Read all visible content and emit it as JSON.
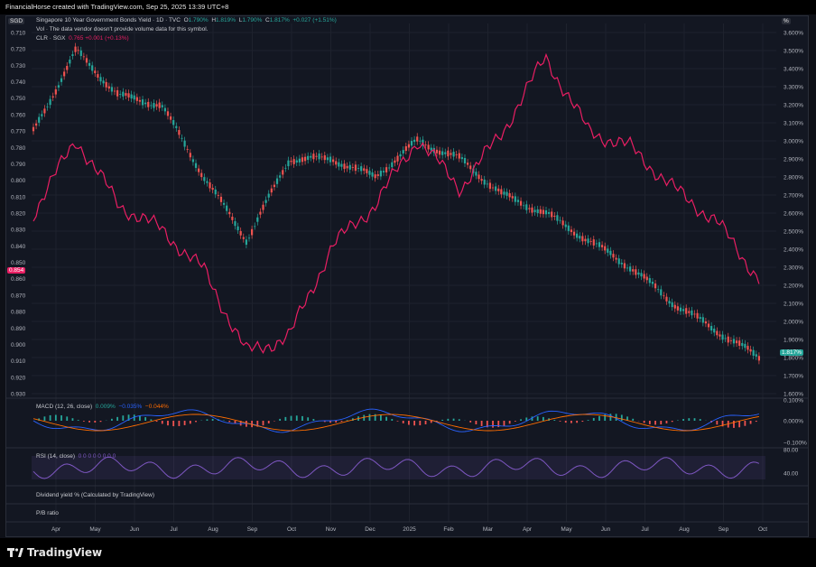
{
  "header": {
    "title": "FinancialHorse created with TradingView.com, Sep 25, 2025 13:39 UTC+8"
  },
  "legend": {
    "main_symbol": "Singapore 10 Year Government Bonds Yield · 1D · TVC",
    "o_label": "O",
    "o_value": "1.790%",
    "h_label": "H",
    "h_value": "1.819%",
    "l_label": "L",
    "l_value": "1.790%",
    "c_label": "C",
    "c_value": "1.817%",
    "change": "+0.027 (+1.51%)",
    "vol_note": "Vol · The data vendor doesn't provide volume data for this symbol.",
    "clr_symbol": "CLR · SGX",
    "clr_value": "0.765 +0.001 (+0.13%)",
    "macd_label": "MACD (12, 26, close)",
    "macd_v1": "0.009%",
    "macd_v2": "−0.035%",
    "macd_v3": "−0.044%",
    "rsi_label": "RSI (14, close)",
    "rsi_values": "0 0 0 0 0 0 0 0",
    "div_label": "Dividend yield % (Calculated by TradingView)",
    "pb_label": "P/B ratio"
  },
  "axes": {
    "left_currency": "SGD",
    "right_unit": "%",
    "left_ticks": [
      "0.710",
      "0.720",
      "0.730",
      "0.740",
      "0.750",
      "0.760",
      "0.770",
      "0.780",
      "0.790",
      "0.800",
      "0.810",
      "0.820",
      "0.830",
      "0.840",
      "0.850",
      "0.860",
      "0.870",
      "0.880",
      "0.890",
      "0.900",
      "0.910",
      "0.920",
      "0.930"
    ],
    "right_ticks": [
      "3.600%",
      "3.500%",
      "3.400%",
      "3.300%",
      "3.200%",
      "3.100%",
      "3.000%",
      "2.900%",
      "2.800%",
      "2.700%",
      "2.600%",
      "2.500%",
      "2.400%",
      "2.300%",
      "2.200%",
      "2.100%",
      "2.000%",
      "1.900%",
      "1.800%",
      "1.700%",
      "1.600%"
    ],
    "x_ticks": [
      "Apr",
      "May",
      "Jun",
      "Jul",
      "Aug",
      "Sep",
      "Oct",
      "Nov",
      "Dec",
      "2025",
      "Feb",
      "Mar",
      "Apr",
      "May",
      "Jun",
      "Jul",
      "Aug",
      "Sep",
      "Oct"
    ],
    "left_badge": "0.854",
    "right_badge": "1.817%",
    "macd_ticks": [
      "0.100%",
      "0.000%",
      "−0.100%"
    ],
    "rsi_ticks": [
      "80.00",
      "40.00"
    ]
  },
  "colors": {
    "bg": "#131722",
    "up": "#26a69a",
    "down": "#ef5350",
    "clr": "#e91e63",
    "macd": "#2962ff",
    "signal": "#ff6d00",
    "rsi": "#7e57c2"
  },
  "chart_data": [
    {
      "type": "line",
      "title": "Singapore 10 Year Government Bonds Yield",
      "ylabel": "%",
      "ylim": [
        1.6,
        3.6
      ],
      "x": [
        "Apr",
        "May",
        "Jun",
        "Jul",
        "Aug",
        "Sep",
        "Oct",
        "Nov",
        "Dec",
        "Jan",
        "Feb",
        "Mar",
        "Apr",
        "May",
        "Jun",
        "Jul",
        "Aug",
        "Sep"
      ],
      "series": [
        {
          "name": "Singapore 10 Year Government Bonds Yield",
          "values": [
            3.05,
            3.5,
            3.25,
            3.2,
            2.8,
            2.45,
            2.9,
            2.9,
            2.8,
            3.0,
            2.9,
            2.7,
            2.6,
            2.45,
            2.3,
            2.1,
            1.95,
            1.8
          ]
        }
      ],
      "last": 1.817
    },
    {
      "type": "line",
      "title": "CLR · SGX",
      "ylabel": "SGD (inverted)",
      "ylim": [
        0.71,
        0.93
      ],
      "x": [
        "Apr",
        "May",
        "Jun",
        "Jul",
        "Aug",
        "Sep",
        "Oct",
        "Nov",
        "Dec",
        "Jan",
        "Feb",
        "Mar",
        "Apr",
        "May",
        "Jun",
        "Jul",
        "Aug",
        "Sep"
      ],
      "series": [
        {
          "name": "CLR · SGX",
          "values": [
            0.82,
            0.775,
            0.815,
            0.83,
            0.855,
            0.905,
            0.895,
            0.84,
            0.815,
            0.775,
            0.805,
            0.77,
            0.725,
            0.77,
            0.78,
            0.805,
            0.825,
            0.86
          ]
        }
      ],
      "last": 0.854
    }
  ]
}
